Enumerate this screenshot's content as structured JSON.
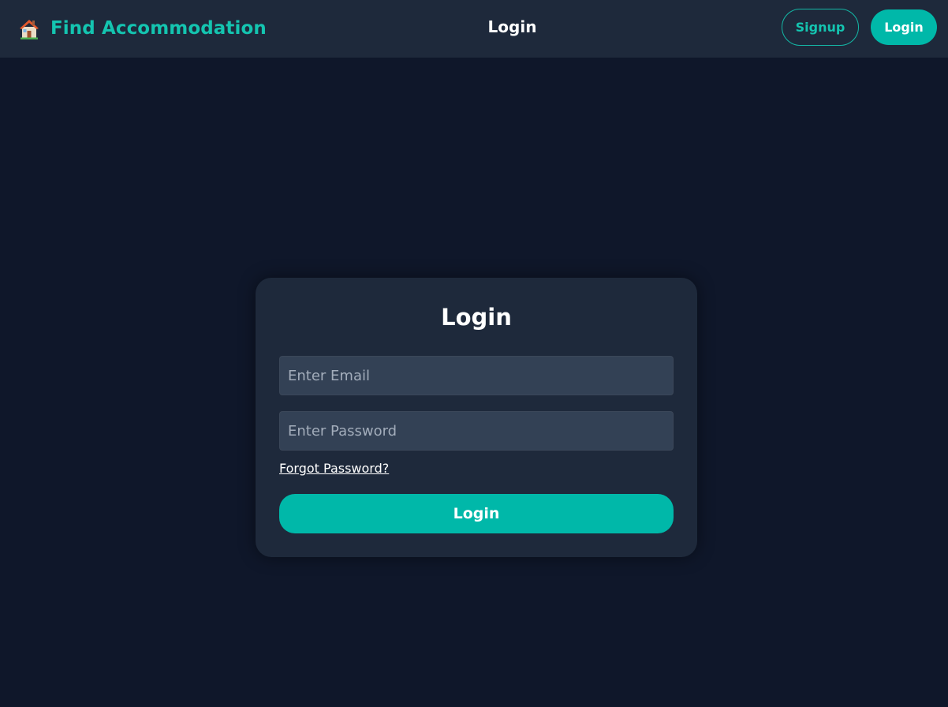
{
  "header": {
    "brand": {
      "icon": "house-icon",
      "name": "Find Accommodation"
    },
    "title": "Login",
    "signup_label": "Signup",
    "login_label": "Login"
  },
  "login_form": {
    "title": "Login",
    "email_placeholder": "Enter Email",
    "email_value": "",
    "password_placeholder": "Enter Password",
    "password_value": "",
    "forgot_label": "Forgot Password?",
    "submit_label": "Login"
  },
  "colors": {
    "page_background": "#0f172a",
    "surface": "#1e293b",
    "input_background": "#334155",
    "accent": "#00b8a9",
    "brand_text": "#14c4b0"
  }
}
